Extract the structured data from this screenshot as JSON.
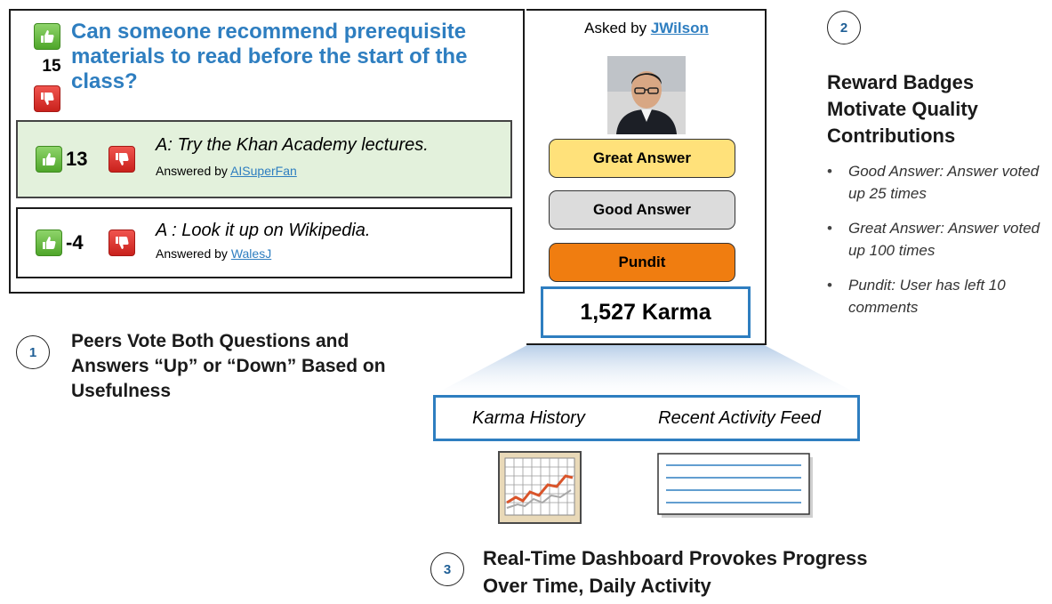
{
  "question": {
    "score": "15",
    "title": "Can someone recommend prerequisite materials to read before the start of the class?"
  },
  "answers": [
    {
      "score": "13",
      "text": "A: Try the Khan Academy lectures.",
      "by_prefix": "Answered by",
      "author": "AISuperFan"
    },
    {
      "score": "-4",
      "text": "A : Look it up on Wikipedia.",
      "by_prefix": "Answered by",
      "author": "WalesJ"
    }
  ],
  "profile": {
    "asked_prefix": "Asked by",
    "asker": "JWilson",
    "badges": [
      "Great Answer",
      "Good Answer",
      "Pundit"
    ],
    "karma": "1,527 Karma"
  },
  "callouts": [
    {
      "number": "1",
      "text": "Peers Vote Both Questions and Answers “Up” or “Down” Based on Usefulness"
    },
    {
      "number": "2",
      "text": "Reward Badges Motivate Quality Contributions"
    },
    {
      "number": "3",
      "text": "Real-Time Dashboard Provokes Progress Over Time, Daily Activity"
    }
  ],
  "badge_rules": [
    "Good Answer: Answer voted up 25 times",
    "Great Answer: Answer voted up 100 times",
    "Pundit: User has left 10 comments"
  ],
  "dashboard": {
    "items": [
      "Karma History",
      "Recent Activity Feed"
    ]
  },
  "colors": {
    "accent": "#2e7ec0",
    "vote_up": "#5cb335",
    "vote_down": "#d9302a",
    "answer_highlight": "#e3f1dc",
    "badge_great": "#ffe17a",
    "badge_good": "#dcdcdc",
    "badge_pundit": "#f07d10"
  }
}
